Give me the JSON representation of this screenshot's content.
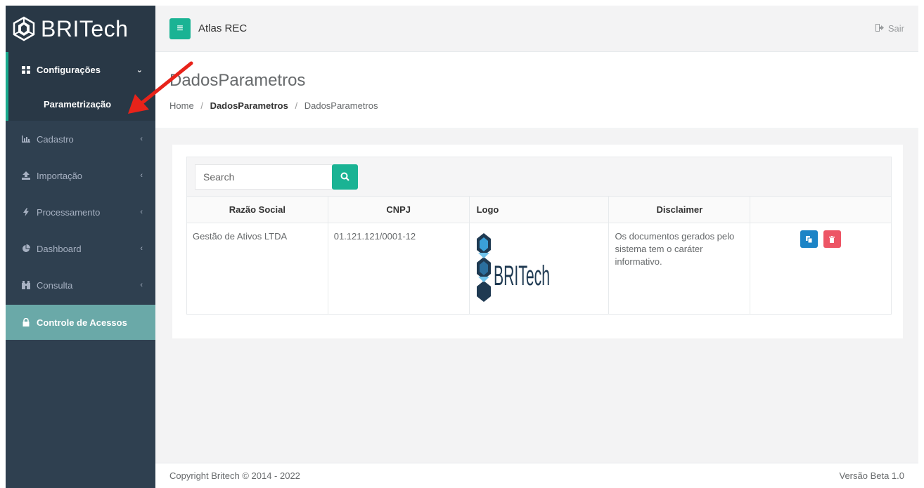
{
  "brand": {
    "name": "BRITech"
  },
  "topbar": {
    "app_title": "Atlas REC",
    "logout_label": "Sair"
  },
  "sidebar": {
    "items": [
      {
        "label": "Configurações",
        "icon": "grid-icon",
        "expanded": true
      },
      {
        "label": "Parametrização",
        "active": true
      },
      {
        "label": "Cadastro",
        "icon": "bar-chart-icon"
      },
      {
        "label": "Importação",
        "icon": "upload-icon"
      },
      {
        "label": "Processamento",
        "icon": "bolt-icon"
      },
      {
        "label": "Dashboard",
        "icon": "pie-chart-icon"
      },
      {
        "label": "Consulta",
        "icon": "binoculars-icon"
      },
      {
        "label": "Controle de Acessos",
        "icon": "lock-icon",
        "highlight": true
      }
    ]
  },
  "page": {
    "title": "DadosParametros",
    "breadcrumb": [
      "Home",
      "DadosParametros",
      "DadosParametros"
    ]
  },
  "search": {
    "placeholder": "Search"
  },
  "table": {
    "headers": [
      "Razão Social",
      "CNPJ",
      "Logo",
      "Disclaimer",
      ""
    ],
    "rows": [
      {
        "razao_social": "Gestão de Ativos LTDA",
        "cnpj": "01.121.121/0001-12",
        "logo_text": "BRITech",
        "disclaimer": "Os documentos gerados pelo sistema tem o caráter informativo."
      }
    ]
  },
  "footer": {
    "copyright": "Copyright Britech © 2014 - 2022",
    "version": "Versão Beta 1.0"
  },
  "colors": {
    "sidebar": "#2f4050",
    "accent": "#1ab394",
    "edit": "#1c84c6",
    "delete": "#ed5565",
    "highlight": "#6aa9a8",
    "arrow": "#e8231a"
  }
}
